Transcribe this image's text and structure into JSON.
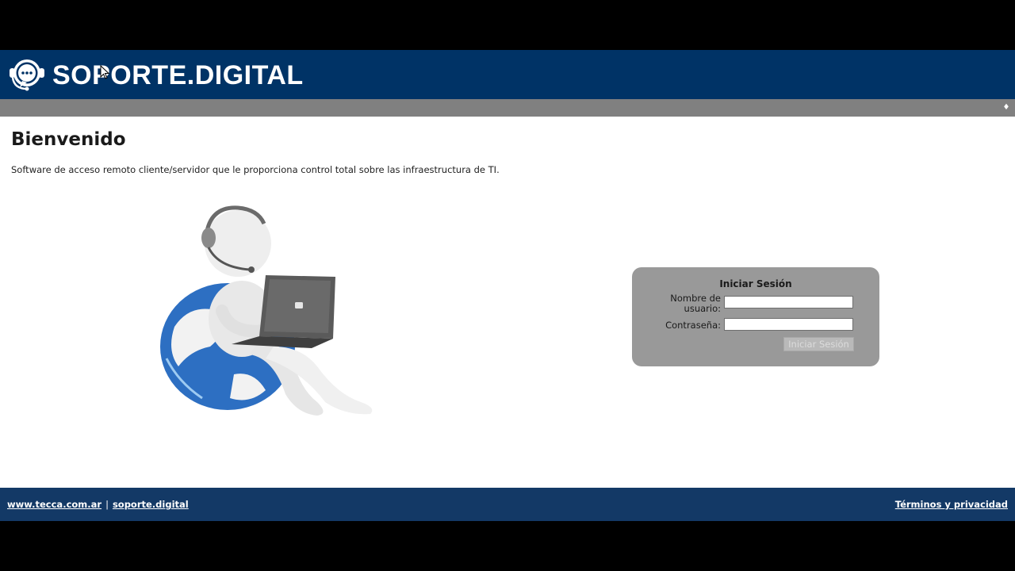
{
  "header": {
    "brand": "SOPORTE.DIGITAL",
    "logo_icon": "headset-chat-icon",
    "background": "#003366"
  },
  "subbar": {
    "toggle_icon": "diamond-toggle-icon",
    "toggle_glyph": "♦",
    "background": "#808080"
  },
  "main": {
    "title": "Bienvenido",
    "intro": "Software de acceso remoto cliente/servidor que le proporciona control total sobre las infraestructura de TI.",
    "illustration": "support-person-laptop-globe-icon"
  },
  "login": {
    "title": "Iniciar Sesión",
    "username_label": "Nombre de usuario:",
    "username_value": "",
    "password_label": "Contraseña:",
    "password_value": "",
    "submit_label": "Iniciar Sesión",
    "background": "#999999"
  },
  "footer": {
    "link1": "www.tecca.com.ar",
    "separator": "|",
    "link2": "soporte.digital",
    "terms": "Términos y privacidad",
    "background": "#133966"
  }
}
